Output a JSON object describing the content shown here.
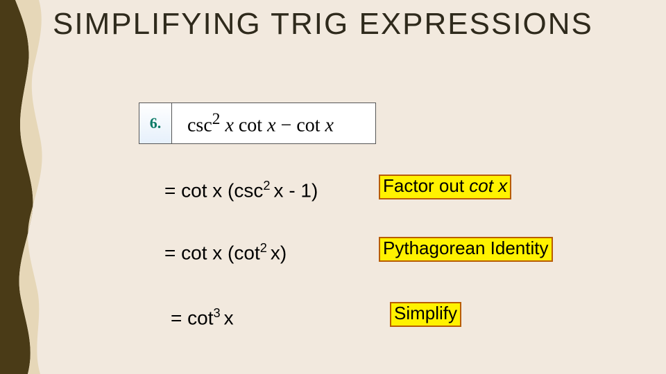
{
  "title": "SIMPLIFYING TRIG EXPRESSIONS",
  "problem": {
    "number": "6.",
    "expression_html": "csc<sup>2</sup>&nbsp;<span class='i'>x</span>&nbsp;cot&nbsp;<span class='i'>x</span>&nbsp;&minus;&nbsp;cot&nbsp;<span class='i'>x</span>"
  },
  "steps": [
    {
      "expr_html": "= cot x (csc<sup>2 </sup>x - 1)",
      "label_html": "Factor out <span class='i'>cot x</span>"
    },
    {
      "expr_html": "= cot x (cot<sup>2 </sup>x)",
      "label_html": "Pythagorean Identity"
    },
    {
      "expr_html": "= cot<sup>3 </sup>x",
      "label_html": "Simplify"
    }
  ]
}
